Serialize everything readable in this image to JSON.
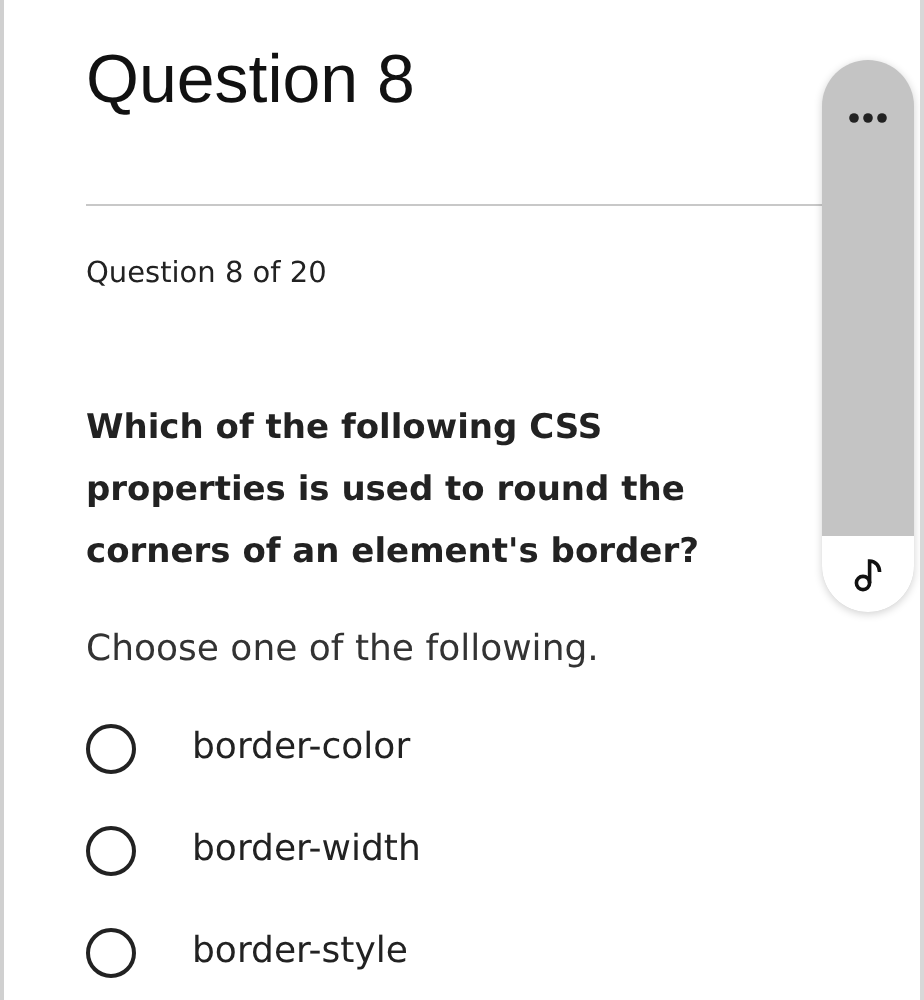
{
  "title": "Question 8",
  "progress": "Question 8 of 20",
  "question": "Which of the following CSS properties is used to round the corners of an element's border?",
  "instruction": "Choose one of the following.",
  "options": [
    {
      "label": "border-color",
      "selected": false
    },
    {
      "label": "border-width",
      "selected": false
    },
    {
      "label": "border-style",
      "selected": false
    }
  ]
}
